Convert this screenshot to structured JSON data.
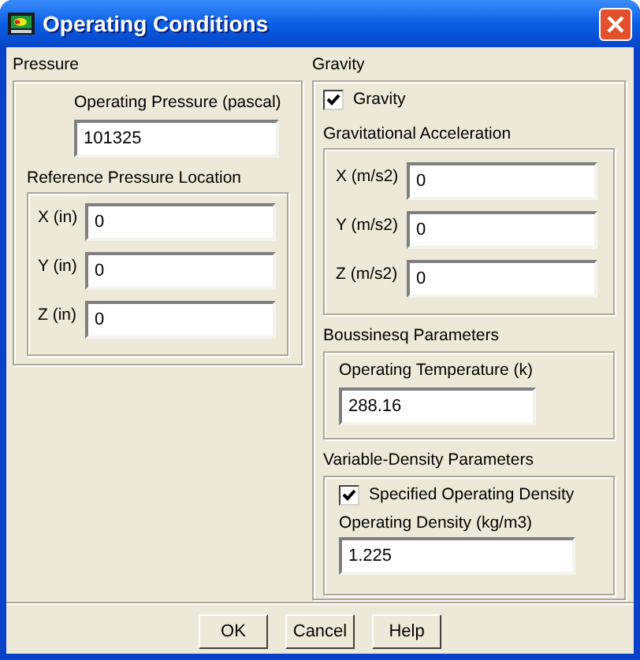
{
  "window": {
    "title": "Operating Conditions"
  },
  "pressure": {
    "title": "Pressure",
    "operating_pressure": {
      "label": "Operating Pressure (pascal)",
      "value": "101325"
    },
    "reference_location": {
      "title": "Reference Pressure Location",
      "fields": [
        {
          "label": "X (in)",
          "value": "0"
        },
        {
          "label": "Y (in)",
          "value": "0"
        },
        {
          "label": "Z (in)",
          "value": "0"
        }
      ]
    }
  },
  "gravity": {
    "title": "Gravity",
    "checkbox": {
      "label": "Gravity",
      "checked": true
    },
    "acceleration": {
      "title": "Gravitational Acceleration",
      "fields": [
        {
          "label": "X (m/s2)",
          "value": "0"
        },
        {
          "label": "Y (m/s2)",
          "value": "0"
        },
        {
          "label": "Z (m/s2)",
          "value": "0"
        }
      ]
    },
    "boussinesq": {
      "title": "Boussinesq Parameters",
      "field": {
        "label": "Operating Temperature (k)",
        "value": "288.16"
      }
    },
    "variable_density": {
      "title": "Variable-Density Parameters",
      "checkbox": {
        "label": "Specified Operating Density",
        "checked": true
      },
      "field": {
        "label": "Operating Density (kg/m3)",
        "value": "1.225"
      }
    }
  },
  "buttons": [
    "OK",
    "Cancel",
    "Help"
  ]
}
